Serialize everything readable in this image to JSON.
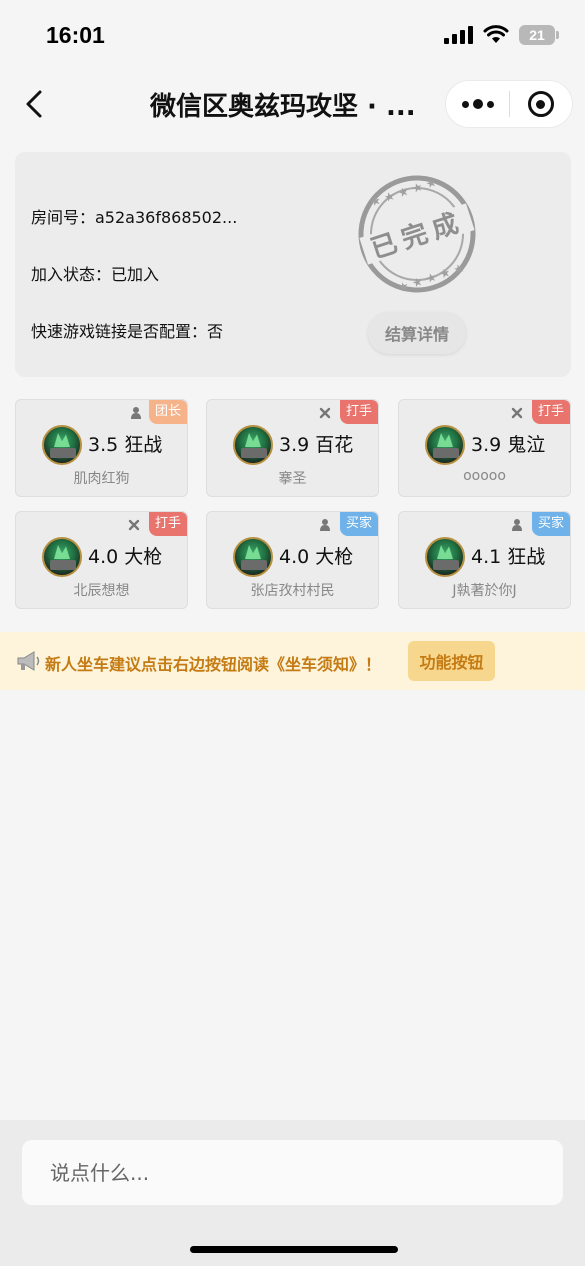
{
  "status_bar": {
    "time": "16:01",
    "battery": "21"
  },
  "nav": {
    "title": "微信区奥兹玛攻坚 · ..."
  },
  "room": {
    "room_no": "房间号：a52a36f868502...",
    "join_status": "加入状态：已加入",
    "quick_link": "快速游戏链接是否配置：否",
    "stamp_text": "已完成",
    "settle_button": "结算详情"
  },
  "members": [
    {
      "score": "3.5",
      "class": "狂战",
      "name": "肌肉红狗",
      "role": "团长",
      "role_color": "#f6b38a"
    },
    {
      "score": "3.9",
      "class": "百花",
      "name": "搴圣",
      "role": "打手",
      "role_color": "#e9736d"
    },
    {
      "score": "3.9",
      "class": "鬼泣",
      "name": "ooooo",
      "role": "打手",
      "role_color": "#e9736d"
    },
    {
      "score": "4.0",
      "class": "大枪",
      "name": "北辰想想",
      "role": "打手",
      "role_color": "#e9736d"
    },
    {
      "score": "4.0",
      "class": "大枪",
      "name": "张店孜村村民",
      "role": "买家",
      "role_color": "#6fb2ea"
    },
    {
      "score": "4.1",
      "class": "狂战",
      "name": "J執著於你J",
      "role": "买家",
      "role_color": "#6fb2ea"
    }
  ],
  "notice": {
    "text": "新人坐车建议点击右边按钮阅读《坐车须知》！",
    "button": "功能按钮"
  },
  "chat": {
    "placeholder": "说点什么..."
  },
  "colors": {
    "accent_text": "#c57b14",
    "notice_bg": "#fdf4db"
  }
}
